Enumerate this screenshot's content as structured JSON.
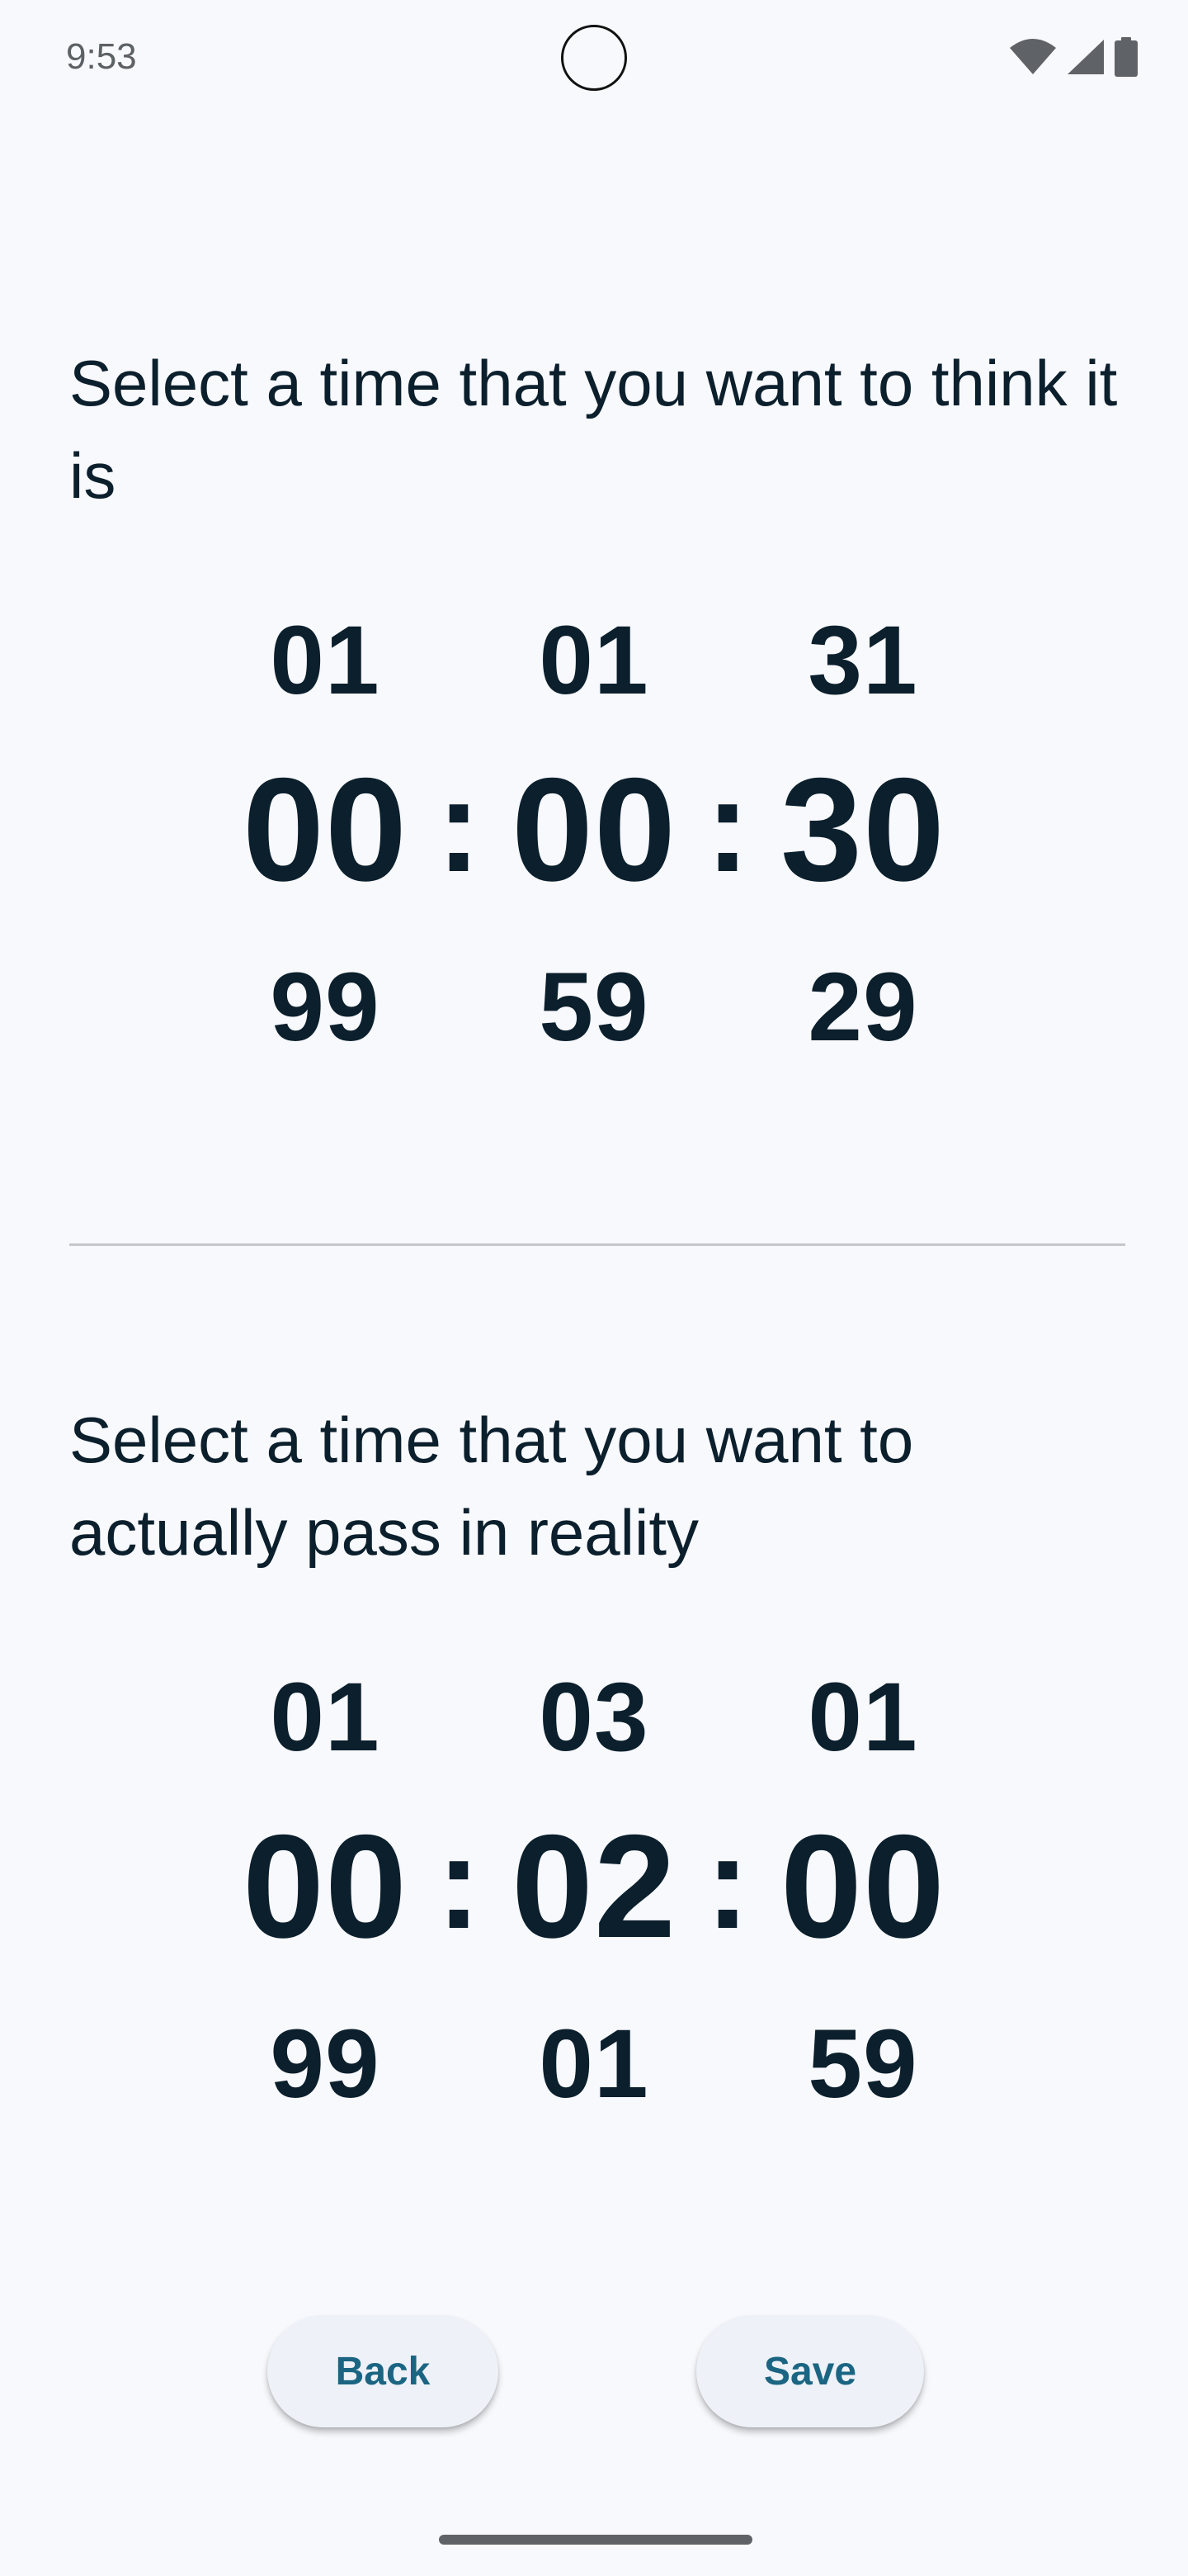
{
  "status_bar": {
    "time": "9:53",
    "icons": [
      "wifi-icon",
      "cellular-signal-icon",
      "battery-icon"
    ]
  },
  "think_section": {
    "prompt": "Select a time that you want to think it is",
    "hours": {
      "prev": "01",
      "current": "00",
      "next": "99"
    },
    "minutes": {
      "prev": "01",
      "current": "00",
      "next": "59"
    },
    "seconds": {
      "prev": "31",
      "current": "30",
      "next": "29"
    },
    "separator": ":"
  },
  "reality_section": {
    "prompt": "Select a time that you want to actually pass in reality",
    "hours": {
      "prev": "01",
      "current": "00",
      "next": "99"
    },
    "minutes": {
      "prev": "03",
      "current": "02",
      "next": "01"
    },
    "seconds": {
      "prev": "01",
      "current": "00",
      "next": "59"
    },
    "separator": ":"
  },
  "buttons": {
    "back_label": "Back",
    "save_label": "Save"
  },
  "colors": {
    "background": "#f8f9fd",
    "text": "#0b1f2c",
    "button_text": "#1b6583",
    "button_bg": "#eef1f7",
    "divider": "#c3c7cc"
  }
}
